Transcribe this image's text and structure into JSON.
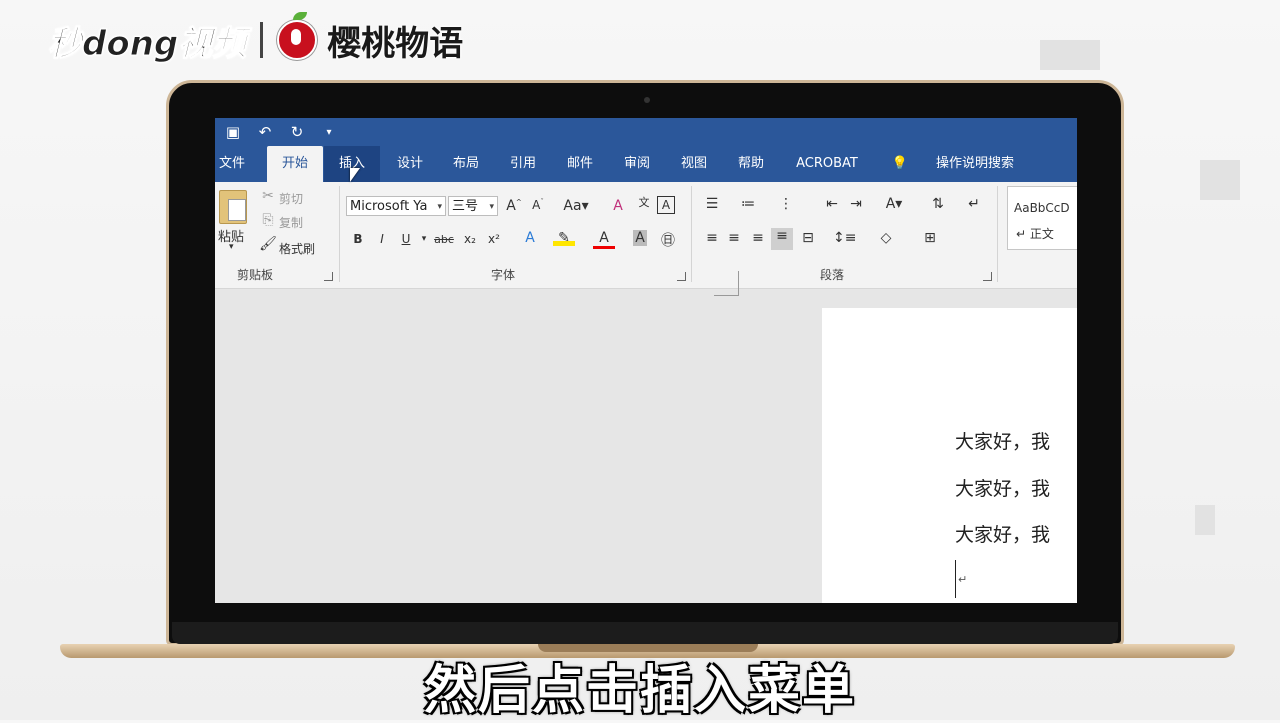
{
  "watermark": {
    "brand1": "秒dong视频",
    "brand2": "樱桃物语"
  },
  "qat": {
    "save_icon": "save-icon",
    "undo_icon": "undo-icon",
    "redo_icon": "redo-icon",
    "customize_icon": "customize-qat-icon"
  },
  "tabs": [
    "文件",
    "开始",
    "插入",
    "设计",
    "布局",
    "引用",
    "邮件",
    "审阅",
    "视图",
    "帮助",
    "ACROBAT"
  ],
  "tell_me": "操作说明搜索",
  "clipboard": {
    "paste": "粘贴",
    "cut": "剪切",
    "copy": "复制",
    "format_painter": "格式刷",
    "label": "剪贴板"
  },
  "font": {
    "name": "Microsoft Ya",
    "size": "三号",
    "label": "字体"
  },
  "paragraph": {
    "label": "段落"
  },
  "styles": {
    "preview": "AaBbCcD",
    "normal": "↵ 正文"
  },
  "document": {
    "lines": [
      "大家好，我",
      "大家好，我",
      "大家好，我"
    ],
    "para_mark": "↵"
  },
  "subtitle": "然后点击插入菜单",
  "colors": {
    "ribbon_blue": "#2b579a",
    "ribbon_bg": "#f3f3f3"
  }
}
